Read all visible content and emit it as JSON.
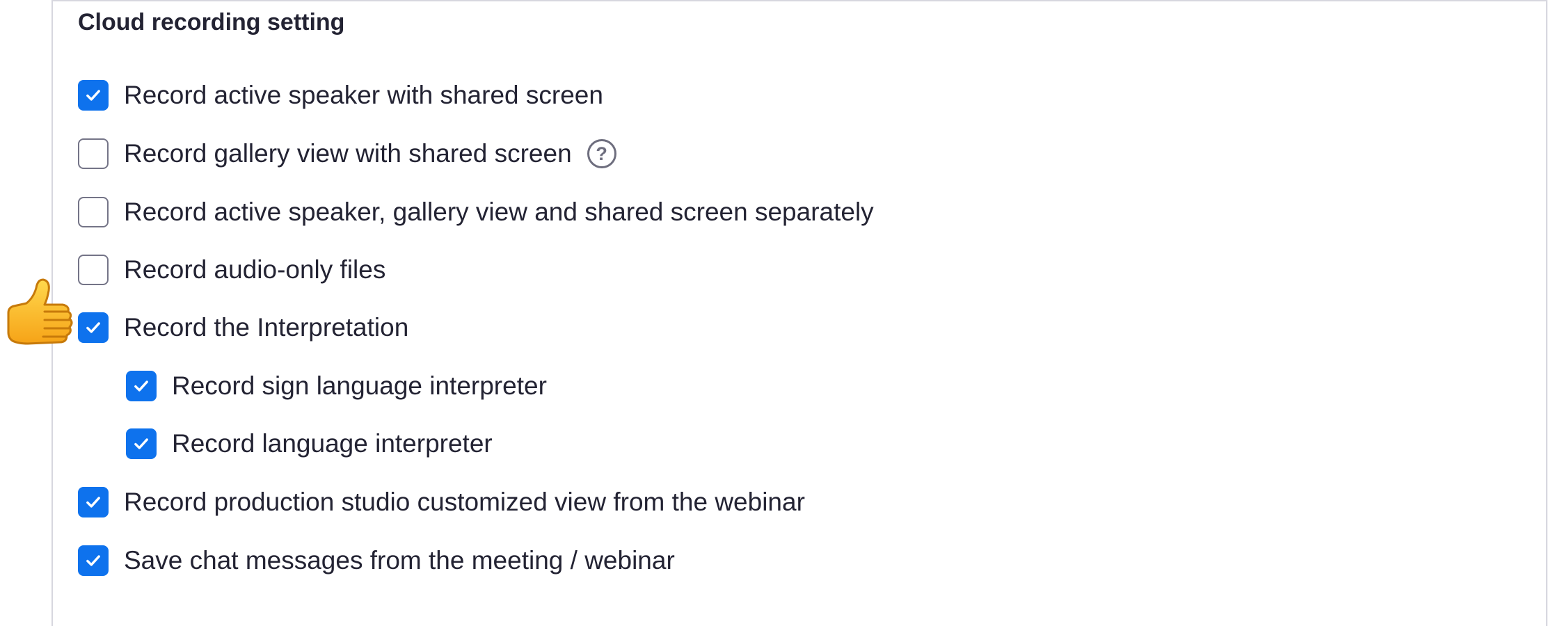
{
  "section": {
    "title": "Cloud recording setting"
  },
  "options": [
    {
      "label": "Record active speaker with shared screen",
      "checked": true
    },
    {
      "label": "Record gallery view with shared screen",
      "checked": false,
      "help": true
    },
    {
      "label": "Record active speaker, gallery view and shared screen separately",
      "checked": false
    },
    {
      "label": "Record audio-only files",
      "checked": false
    },
    {
      "label": "Record the Interpretation",
      "checked": true
    },
    {
      "label": "Record sign language interpreter",
      "checked": true
    },
    {
      "label": "Record language interpreter",
      "checked": true
    },
    {
      "label": "Record production studio customized view from the webinar",
      "checked": true
    },
    {
      "label": "Save chat messages from the meeting / webinar",
      "checked": true
    }
  ],
  "help_icon": {
    "glyph": "?",
    "icon": "question-circle-icon"
  },
  "annotation": {
    "icon": "thumbs-up-icon"
  },
  "colors": {
    "accent": "#0e72ed",
    "text": "#232333",
    "border": "#747487"
  }
}
